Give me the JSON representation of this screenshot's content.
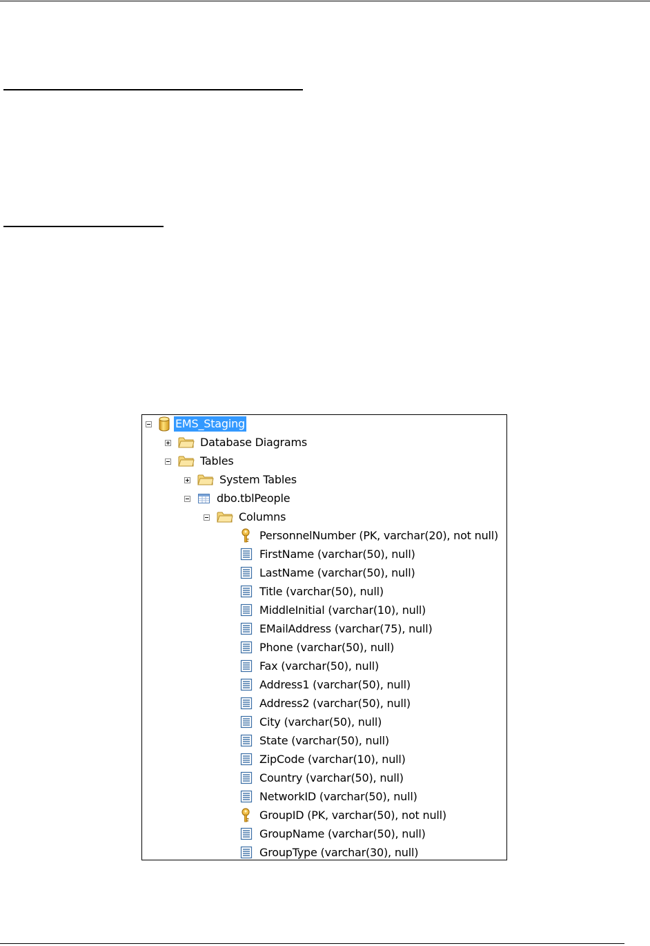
{
  "tree": {
    "root": {
      "label": "EMS_Staging",
      "icon": "database-icon",
      "expanded": true,
      "selected": true
    },
    "nodes": [
      {
        "label": "Database Diagrams",
        "icon": "folder-icon",
        "toggle": "plus",
        "level": 1
      },
      {
        "label": "Tables",
        "icon": "folder-icon",
        "toggle": "minus",
        "level": 1
      },
      {
        "label": "System Tables",
        "icon": "folder-icon",
        "toggle": "plus",
        "level": 2
      },
      {
        "label": "dbo.tblPeople",
        "icon": "table-icon",
        "toggle": "minus",
        "level": 2
      },
      {
        "label": "Columns",
        "icon": "folder-icon",
        "toggle": "minus",
        "level": 3
      }
    ],
    "columns": [
      {
        "label": "PersonnelNumber (PK, varchar(20), not null)",
        "icon": "key-icon"
      },
      {
        "label": "FirstName (varchar(50), null)",
        "icon": "column-icon"
      },
      {
        "label": "LastName (varchar(50), null)",
        "icon": "column-icon"
      },
      {
        "label": "Title (varchar(50), null)",
        "icon": "column-icon"
      },
      {
        "label": "MiddleInitial (varchar(10), null)",
        "icon": "column-icon"
      },
      {
        "label": "EMailAddress (varchar(75), null)",
        "icon": "column-icon"
      },
      {
        "label": "Phone (varchar(50), null)",
        "icon": "column-icon"
      },
      {
        "label": "Fax (varchar(50), null)",
        "icon": "column-icon"
      },
      {
        "label": "Address1 (varchar(50), null)",
        "icon": "column-icon"
      },
      {
        "label": "Address2 (varchar(50), null)",
        "icon": "column-icon"
      },
      {
        "label": "City (varchar(50), null)",
        "icon": "column-icon"
      },
      {
        "label": "State (varchar(50), null)",
        "icon": "column-icon"
      },
      {
        "label": "ZipCode (varchar(10), null)",
        "icon": "column-icon"
      },
      {
        "label": "Country (varchar(50), null)",
        "icon": "column-icon"
      },
      {
        "label": "NetworkID (varchar(50), null)",
        "icon": "column-icon"
      },
      {
        "label": "GroupID (PK, varchar(50), not null)",
        "icon": "key-icon"
      },
      {
        "label": "GroupName (varchar(50), null)",
        "icon": "column-icon"
      },
      {
        "label": "GroupType (varchar(30), null)",
        "icon": "column-icon"
      }
    ]
  },
  "colors": {
    "selection": "#3399ff",
    "folder": "#e8c25a",
    "key": "#e0a020",
    "column_icon": "#3a6ea5"
  }
}
